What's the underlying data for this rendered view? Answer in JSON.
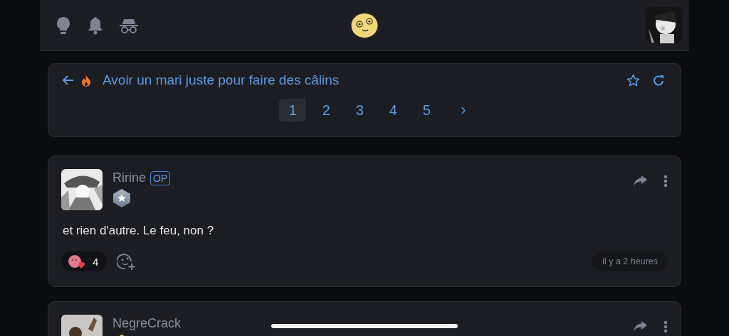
{
  "topic": {
    "title": "Avoir un mari juste pour faire des câlins",
    "pages": [
      {
        "label": "1",
        "selected": true
      },
      {
        "label": "2",
        "selected": false
      },
      {
        "label": "3",
        "selected": false
      },
      {
        "label": "4",
        "selected": false
      },
      {
        "label": "5",
        "selected": false
      }
    ],
    "next": "›"
  },
  "posts": [
    {
      "author": "Ririne",
      "badge": "OP",
      "body": "et rien d'autre. Le feu, non ?",
      "reactions": [
        {
          "count": "4"
        }
      ],
      "time": "il y a 2 heures"
    },
    {
      "author": "NegreCrack"
    }
  ]
}
